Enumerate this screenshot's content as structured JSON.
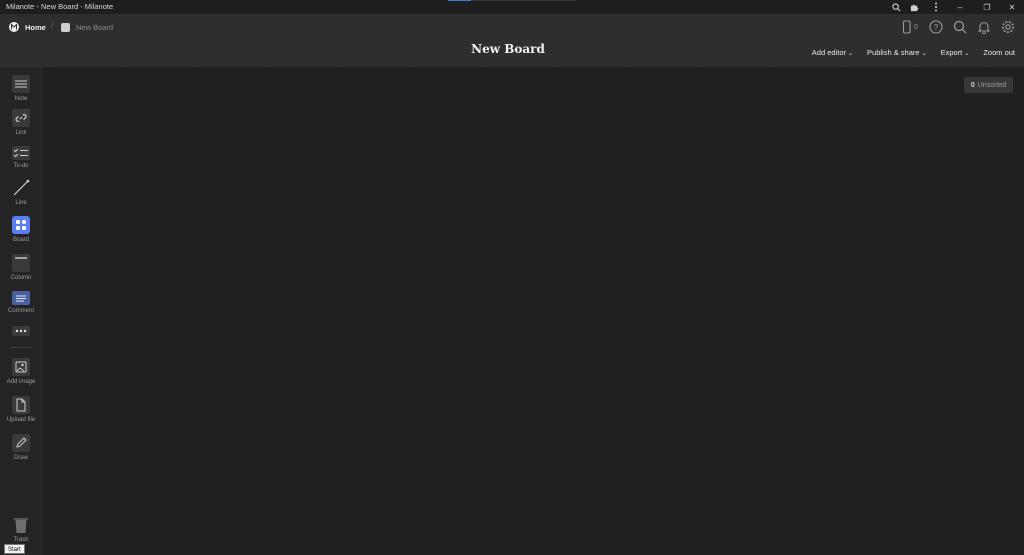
{
  "window": {
    "title": "Milanote - New Board - Milanote",
    "load_progress": 0.18,
    "controls": {
      "search": "search-icon",
      "extensions": "puzzle-icon",
      "menu": "more-vertical-icon",
      "minimize": "–",
      "restore": "❐",
      "close": "✕"
    }
  },
  "breadcrumb": {
    "home": "Home",
    "separator": "/",
    "board": "New Board"
  },
  "board": {
    "title": "New Board"
  },
  "header": {
    "device_count": "0",
    "actions": [
      {
        "label": "Add editor",
        "chevron": "⌄"
      },
      {
        "label": "Publish & share",
        "chevron": "⌄"
      },
      {
        "label": "Export",
        "chevron": "⌄"
      },
      {
        "label": "Zoom out",
        "chevron": ""
      }
    ]
  },
  "sidebar": {
    "tools": [
      {
        "label": "Note",
        "icon": "note-icon"
      },
      {
        "label": "Link",
        "icon": "link-icon"
      },
      {
        "label": "To-do",
        "icon": "todo-icon"
      },
      {
        "label": "Line",
        "icon": "line-icon"
      },
      {
        "label": "Board",
        "icon": "board-icon"
      },
      {
        "label": "Column",
        "icon": "column-icon"
      },
      {
        "label": "Comment",
        "icon": "comment-icon"
      },
      {
        "label": "",
        "icon": "more-horizontal-icon"
      },
      {
        "label": "Add image",
        "icon": "image-icon"
      },
      {
        "label": "Upload file",
        "icon": "file-icon"
      },
      {
        "label": "Draw",
        "icon": "pencil-icon"
      }
    ],
    "trash": "Trash"
  },
  "unsorted": {
    "count": "0",
    "label": "Unsorted"
  },
  "taskbar_tooltip": "Start",
  "colors": {
    "accent_board": "#5b7ff0",
    "background": "#202020",
    "header": "#2e2e2e"
  }
}
